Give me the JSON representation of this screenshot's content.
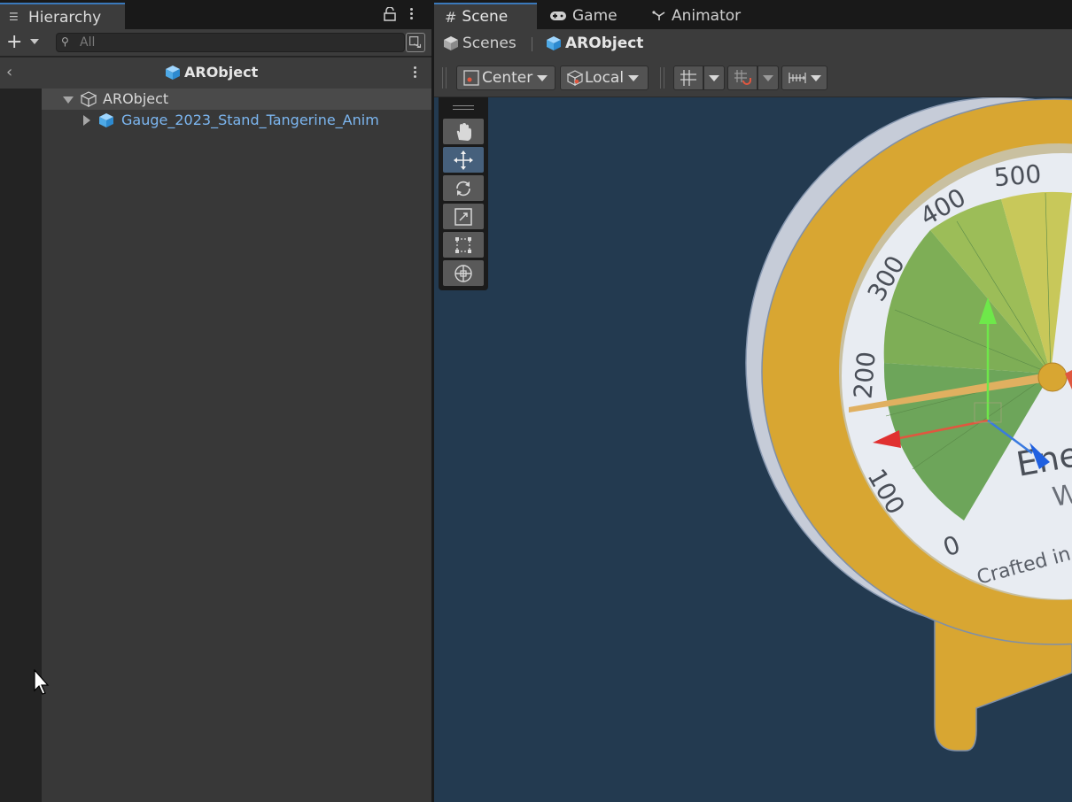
{
  "hierarchy": {
    "tab_label": "Hierarchy",
    "search_placeholder": "All",
    "root_title": "ARObject",
    "rows": [
      {
        "label": "ARObject"
      },
      {
        "label": "Gauge_2023_Stand_Tangerine_Anim"
      }
    ]
  },
  "scene": {
    "tabs": [
      {
        "label": "Scene"
      },
      {
        "label": "Game"
      },
      {
        "label": "Animator"
      }
    ],
    "breadcrumbs": [
      {
        "label": "Scenes"
      },
      {
        "label": "ARObject"
      }
    ],
    "pivot_dropdown": "Center",
    "space_dropdown": "Local",
    "gauge": {
      "ticks": [
        "0",
        "100",
        "200",
        "300",
        "400",
        "500"
      ],
      "title_partial": "Ene",
      "unit_partial": "Wa",
      "footer_partial": "Crafted in Conne"
    }
  },
  "colors": {
    "accent": "#3a79bb",
    "viewport_bg": "#233a50",
    "gauge_body": "#d8a632",
    "link_blue": "#7cb6f0"
  }
}
